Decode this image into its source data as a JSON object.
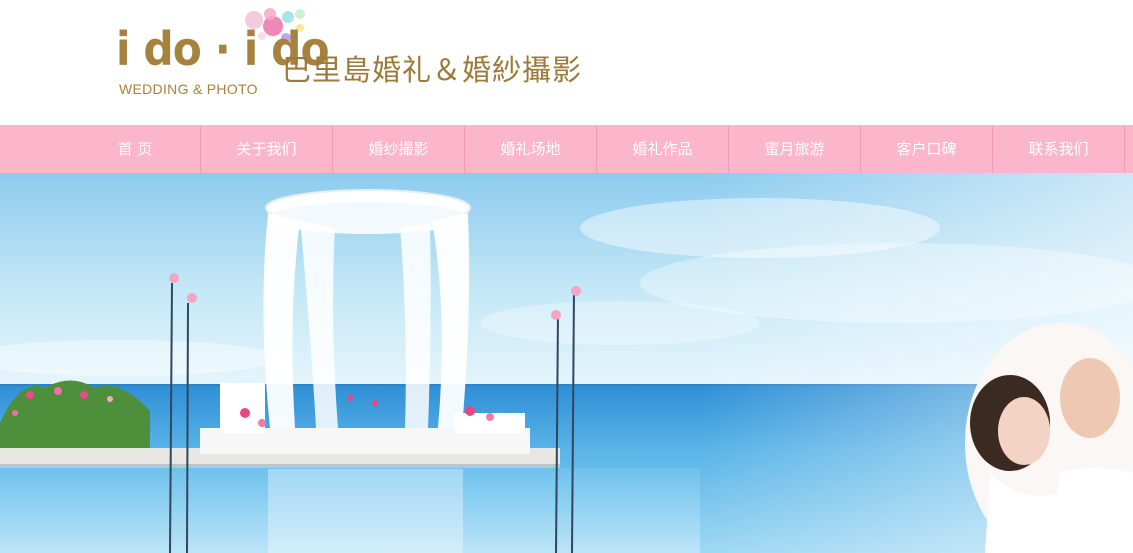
{
  "logo": {
    "main_text": "i do · i do",
    "sub_text": "WEDDING & PHOTO"
  },
  "header": {
    "tagline": "巴里島婚礼＆婚紗攝影"
  },
  "nav": {
    "items": [
      {
        "label": "首 页"
      },
      {
        "label": "关于我们"
      },
      {
        "label": "婚纱撮影"
      },
      {
        "label": "婚礼场地"
      },
      {
        "label": "婚礼作品"
      },
      {
        "label": "蜜月旅游"
      },
      {
        "label": "客户口碑"
      },
      {
        "label": "联系我们"
      }
    ]
  },
  "theme": {
    "brand_gold": "#a6823f",
    "nav_pink": "#fcb6cc",
    "nav_text": "#ffffff",
    "sky_blue": "#9fd6f2",
    "sea_blue": "#4aa8e0"
  },
  "hero": {
    "icon": "wedding-gazebo-ocean-photo"
  }
}
